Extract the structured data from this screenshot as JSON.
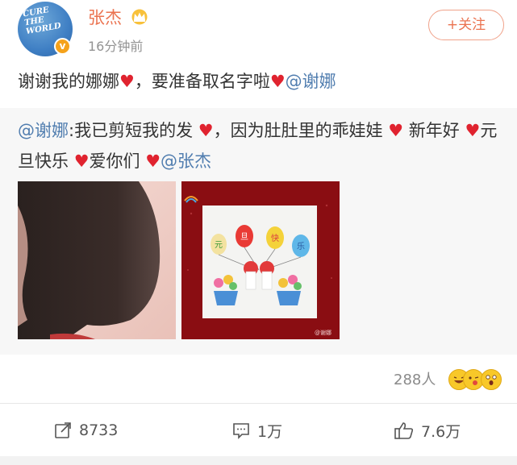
{
  "post": {
    "username": "张杰",
    "timestamp": "16分钟前",
    "follow_label": "+关注",
    "avatar_text": "CURE THE WORLD",
    "text_part1": "谢谢我的娜娜",
    "text_part2": "，要准备取名字啦",
    "text_mention": "@谢娜"
  },
  "repost": {
    "mention_start": "@谢娜",
    "seg1": ":我已剪短我的发",
    "seg2": "，因为肚肚里的乖娃娃",
    "seg3": "新年好",
    "seg4": "元旦快乐",
    "seg5": "爱你们",
    "mention_end": "@张杰",
    "image2_balloons": [
      "元",
      "旦",
      "快",
      "乐"
    ],
    "image2_watermark": "@谢娜"
  },
  "icons": {
    "heart": "♥",
    "crown": "crown-icon",
    "verified": "v"
  },
  "reactions": {
    "count_label": "288人"
  },
  "actions": {
    "repost_count": "8733",
    "comment_count": "1万",
    "like_count": "7.6万"
  },
  "colors": {
    "accent": "#eb7350",
    "heart": "#e0232f",
    "mention": "#507daf",
    "verified": "#f5a21b"
  }
}
